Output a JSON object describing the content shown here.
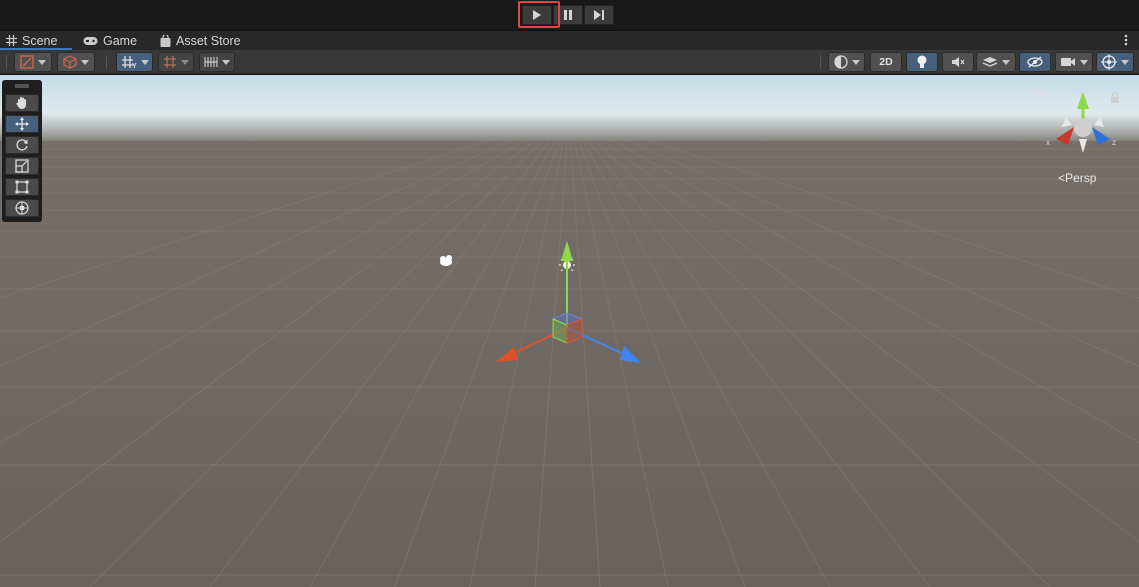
{
  "playbar": {
    "play_icon": "play-icon",
    "pause_icon": "pause-icon",
    "step_icon": "step-icon",
    "highlight_color": "#e04848"
  },
  "tabs": [
    {
      "label": "Scene",
      "icon": "grid-icon"
    },
    {
      "label": "Game",
      "icon": "gamepad-icon"
    },
    {
      "label": "Asset Store",
      "icon": "shopping-bag-icon"
    }
  ],
  "toolbar": {
    "toggle_2d_label": "2D",
    "accent": "#46607c"
  },
  "viewport": {
    "sky_top": "#c6dfe9",
    "ground": "#6c645f",
    "persp_label": "Persp",
    "axis_labels": {
      "y": "y",
      "x": "x",
      "z": "z"
    }
  },
  "tools": [
    {
      "name": "hand-tool",
      "active": false
    },
    {
      "name": "move-tool",
      "active": true
    },
    {
      "name": "rotate-tool",
      "active": false
    },
    {
      "name": "scale-tool",
      "active": false
    },
    {
      "name": "rect-tool",
      "active": false
    },
    {
      "name": "transform-tool",
      "active": false
    }
  ]
}
